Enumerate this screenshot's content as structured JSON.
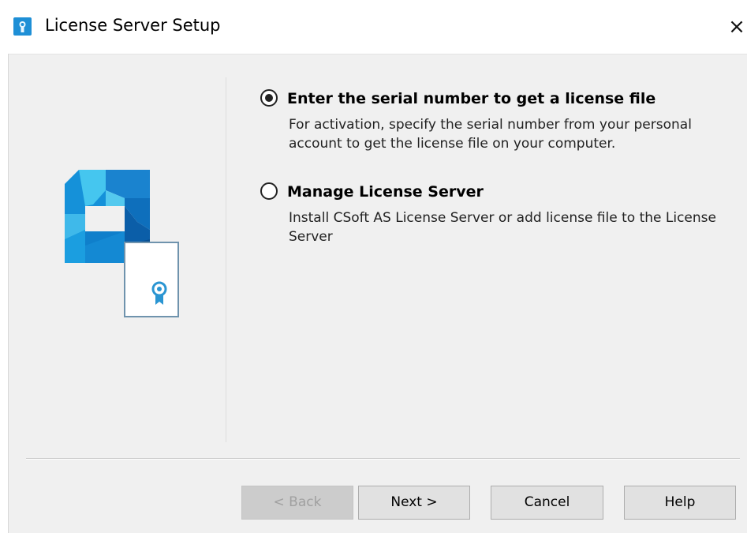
{
  "window": {
    "title": "License Server Setup",
    "close_glyph": "×",
    "icon": "license-server-app-icon"
  },
  "logo": {
    "icon": "license-certificate-logo",
    "colors": {
      "primary": "#1a8ad4",
      "dark": "#0d5fa3",
      "light": "#4cc3ee",
      "cert_border": "#7a9fb8",
      "seal": "#2a95d2"
    }
  },
  "options": [
    {
      "label": "Enter the serial number to get a license file",
      "description": "For activation, specify the serial number from your personal account to get the license file on your computer.",
      "selected": true
    },
    {
      "label": "Manage License Server",
      "description": "Install CSoft AS License Server or add license file to the License Server",
      "selected": false
    }
  ],
  "buttons": {
    "back": "< Back",
    "next": "Next >",
    "cancel": "Cancel",
    "help": "Help"
  }
}
